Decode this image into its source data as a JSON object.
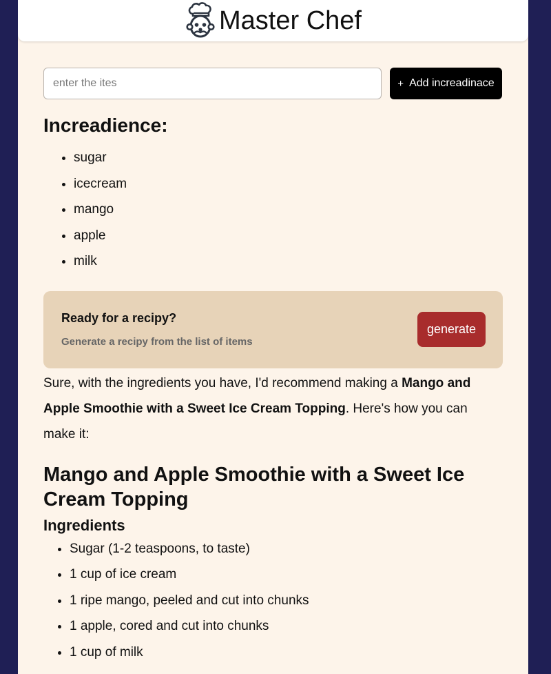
{
  "header": {
    "title": "Master Chef",
    "logo_icon": "chef-icon"
  },
  "form": {
    "input_placeholder": "enter the ites",
    "input_value": "",
    "add_button_icon": "+",
    "add_button_label": "Add increadinace"
  },
  "ingredients": {
    "heading": "Increadience:",
    "items": [
      "sugar",
      "icecream",
      "mango",
      "apple",
      "milk"
    ]
  },
  "cta": {
    "title": "Ready for a recipy?",
    "subtitle": "Generate a recipy from the list of items",
    "button_label": "generate"
  },
  "recipe": {
    "intro_before": "Sure, with the ingredients you have, I'd recommend making a ",
    "intro_bold": "Mango and Apple Smoothie with a Sweet Ice Cream Topping",
    "intro_after": ". Here's how you can make it:",
    "title": "Mango and Apple Smoothie with a Sweet Ice Cream Topping",
    "ingredients_heading": "Ingredients",
    "ingredients": [
      "Sugar (1-2 teaspoons, to taste)",
      "1 cup of ice cream",
      "1 ripe mango, peeled and cut into chunks",
      "1 apple, cored and cut into chunks",
      "1 cup of milk"
    ]
  },
  "colors": {
    "page_background": "#1f1f55",
    "card_background": "#fdf4ea",
    "cta_background": "#e7d3b8",
    "generate_button": "#a82c2c",
    "add_button": "#000000"
  }
}
